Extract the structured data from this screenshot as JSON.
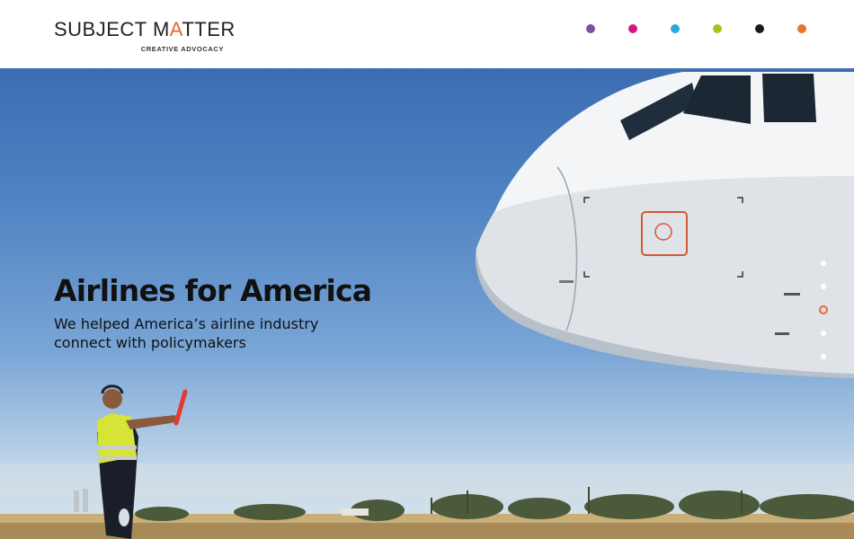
{
  "header": {
    "logo": {
      "text_a": "SUBJECT M",
      "text_accent": "A",
      "text_b": "TTER",
      "tagline": "CREATIVE ADVOCACY"
    },
    "nav_dots": [
      {
        "color": "#7b4fa3"
      },
      {
        "color": "#d4158a"
      },
      {
        "color": "#2aa7df"
      },
      {
        "color": "#a6c51b"
      },
      {
        "color": "#1a1a1a"
      },
      {
        "color": "#e8772e"
      }
    ]
  },
  "hero": {
    "title": "Airlines for America",
    "subtitle": "We helped America’s airline industry connect with policymakers",
    "pager": {
      "count": 5,
      "active_index": 2,
      "active_color": "#e4702c"
    }
  }
}
